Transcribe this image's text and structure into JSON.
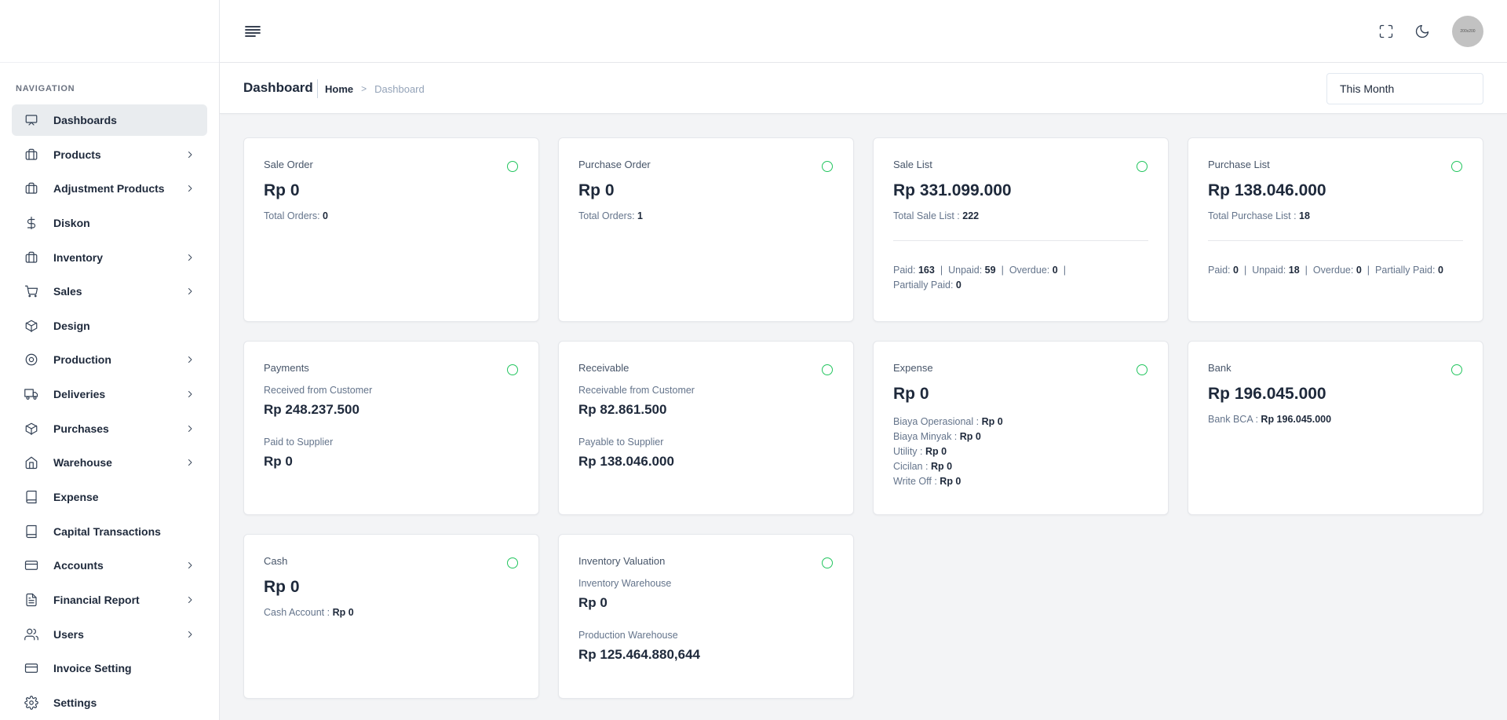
{
  "header": {
    "avatar_text": "200x200"
  },
  "page": {
    "title": "Dashboard",
    "breadcrumb": {
      "home": "Home",
      "separator": ">",
      "current": "Dashboard"
    },
    "period": "This Month"
  },
  "sidebar": {
    "heading": "NAVIGATION",
    "items": [
      {
        "label": "Dashboards",
        "icon": "monitor-icon",
        "has_children": false,
        "active": true
      },
      {
        "label": "Products",
        "icon": "briefcase-icon",
        "has_children": true
      },
      {
        "label": "Adjustment Products",
        "icon": "briefcase-icon",
        "has_children": true
      },
      {
        "label": "Diskon",
        "icon": "dollar-icon",
        "has_children": false
      },
      {
        "label": "Inventory",
        "icon": "briefcase-icon",
        "has_children": true
      },
      {
        "label": "Sales",
        "icon": "cart-icon",
        "has_children": true
      },
      {
        "label": "Design",
        "icon": "box-icon",
        "has_children": false
      },
      {
        "label": "Production",
        "icon": "target-icon",
        "has_children": true
      },
      {
        "label": "Deliveries",
        "icon": "truck-icon",
        "has_children": true
      },
      {
        "label": "Purchases",
        "icon": "box-icon",
        "has_children": true
      },
      {
        "label": "Warehouse",
        "icon": "home-icon",
        "has_children": true
      },
      {
        "label": "Expense",
        "icon": "book-icon",
        "has_children": false
      },
      {
        "label": "Capital Transactions",
        "icon": "book-icon",
        "has_children": false
      },
      {
        "label": "Accounts",
        "icon": "credit-card-icon",
        "has_children": true
      },
      {
        "label": "Financial Report",
        "icon": "file-text-icon",
        "has_children": true
      },
      {
        "label": "Users",
        "icon": "users-icon",
        "has_children": true
      },
      {
        "label": "Invoice Setting",
        "icon": "credit-card-icon",
        "has_children": false
      },
      {
        "label": "Settings",
        "icon": "gear-icon",
        "has_children": false
      }
    ]
  },
  "cards": {
    "sale_order": {
      "title": "Sale Order",
      "amount": "Rp 0",
      "orders_label": "Total Orders:",
      "orders_value": "0"
    },
    "purchase_order": {
      "title": "Purchase Order",
      "amount": "Rp 0",
      "orders_label": "Total Orders:",
      "orders_value": "1"
    },
    "sale_list": {
      "title": "Sale List",
      "amount": "Rp 331.099.000",
      "total_label": "Total Sale List :",
      "total_value": "222",
      "paid_label": "Paid:",
      "paid_value": "163",
      "unpaid_label": "Unpaid:",
      "unpaid_value": "59",
      "overdue_label": "Overdue:",
      "overdue_value": "0",
      "partial_label": "Partially Paid:",
      "partial_value": "0",
      "pipe": "|"
    },
    "purchase_list": {
      "title": "Purchase List",
      "amount": "Rp 138.046.000",
      "total_label": "Total Purchase List :",
      "total_value": "18",
      "paid_label": "Paid:",
      "paid_value": "0",
      "unpaid_label": "Unpaid:",
      "unpaid_value": "18",
      "overdue_label": "Overdue:",
      "overdue_value": "0",
      "partial_label": "Partially Paid:",
      "partial_value": "0",
      "pipe": "|"
    },
    "payments": {
      "title": "Payments",
      "received_label": "Received from Customer",
      "received_value": "Rp 248.237.500",
      "paid_label": "Paid to Supplier",
      "paid_value": "Rp 0"
    },
    "receivable": {
      "title": "Receivable",
      "receivable_label": "Receivable from Customer",
      "receivable_value": "Rp 82.861.500",
      "payable_label": "Payable to Supplier",
      "payable_value": "Rp 138.046.000"
    },
    "expense": {
      "title": "Expense",
      "amount": "Rp 0",
      "items": [
        {
          "label": "Biaya Operasional :",
          "value": "Rp 0"
        },
        {
          "label": "Biaya Minyak :",
          "value": "Rp 0"
        },
        {
          "label": "Utility :",
          "value": "Rp 0"
        },
        {
          "label": "Cicilan :",
          "value": "Rp 0"
        },
        {
          "label": "Write Off :",
          "value": "Rp 0"
        }
      ]
    },
    "bank": {
      "title": "Bank",
      "amount": "Rp 196.045.000",
      "account_label": "Bank BCA :",
      "account_value": "Rp 196.045.000"
    },
    "cash": {
      "title": "Cash",
      "amount": "Rp 0",
      "account_label": "Cash Account :",
      "account_value": "Rp 0"
    },
    "inventory_valuation": {
      "title": "Inventory Valuation",
      "warehouse_label": "Inventory Warehouse",
      "warehouse_value": "Rp 0",
      "production_label": "Production Warehouse",
      "production_value": "Rp 125.464.880,644"
    }
  },
  "colors": {
    "accent_status": "#22c55e",
    "active_nav_bg": "#e9ecef",
    "page_bg": "#f3f4f6"
  }
}
